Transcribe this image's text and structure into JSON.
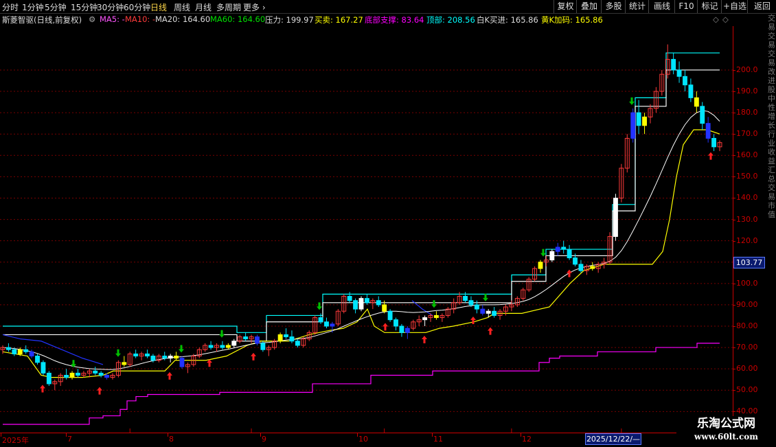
{
  "toolbar": {
    "periods": [
      "分时",
      "1分钟",
      "5分钟",
      "15分钟",
      "30分钟",
      "60分钟",
      "日线",
      "周线",
      "月线",
      "多周期",
      "更多"
    ],
    "active": "日线",
    "right_buttons": [
      "复权",
      "叠加",
      "多股",
      "统计",
      "画线",
      "F10",
      "标记",
      "+自选",
      "返回"
    ]
  },
  "infobar": {
    "title": "斯菱智驱(日线,前复权)",
    "ma5": "MA5: -",
    "ma10": "MA10: -",
    "ma20": "MA20: 164.60",
    "ma60": "MA60: 164.60",
    "pressure": "压力: 199.97",
    "trade": "买卖: 167.27",
    "bottom_support": "底部支撑: 83.64",
    "top": "顶部: 208.56",
    "white_k_buy": "白K买进: 165.86",
    "yellow_k_add": "黄K加码: 165.86"
  },
  "colors": {
    "up": "#ff3b3b",
    "down": "#00e5ff",
    "yellow": "#ffff00",
    "blue": "#0000ff",
    "magenta": "#ff00ff",
    "cyan": "#00ffff",
    "white": "#ffffff",
    "grid": "#7a0000",
    "axis": "#c00000",
    "buy_arrow": "#ff2020",
    "sell_arrow": "#00c000"
  },
  "price_axis": {
    "ticks": [
      40,
      50,
      60,
      70,
      80,
      90,
      100,
      110,
      120,
      130,
      140,
      150,
      160,
      170,
      180,
      190,
      200
    ],
    "labels": [
      "40.00",
      "50.00",
      "60.00",
      "70.00",
      "80.00",
      "90.00",
      "100.0",
      "110.0",
      "120.0",
      "130.0",
      "140.0",
      "150.0",
      "160.0",
      "170.0",
      "180.0",
      "190.0",
      "200.0"
    ],
    "current_price": "103.77"
  },
  "time_axis": {
    "labels": [
      "2025年",
      "7",
      "8",
      "9",
      "10",
      "11",
      "12"
    ],
    "cursor_date": "2025/12/22/—"
  },
  "right_strip_text": "交易交易交易改进股中性增长行业收益汇总交易市值",
  "watermark": {
    "line1": "乐淘公式网",
    "line2": "www.60lt.com"
  },
  "chart_data": {
    "type": "candlestick",
    "title": "斯菱智驱(日线,前复权)",
    "ylim": [
      34,
      218
    ],
    "months": [
      "2025年",
      "7",
      "8",
      "9",
      "10",
      "11",
      "12"
    ],
    "candles": [
      [
        69,
        71,
        67,
        70
      ],
      [
        70,
        72,
        68,
        69
      ],
      [
        69,
        70,
        66,
        67
      ],
      [
        67,
        70,
        66,
        69
      ],
      [
        69,
        71,
        67,
        68
      ],
      [
        68,
        69,
        65,
        66
      ],
      [
        66,
        67,
        62,
        63
      ],
      [
        63,
        64,
        57,
        58
      ],
      [
        58,
        59,
        52,
        53
      ],
      [
        53,
        55,
        50,
        54
      ],
      [
        54,
        58,
        52,
        57
      ],
      [
        57,
        60,
        55,
        56
      ],
      [
        56,
        59,
        55,
        58
      ],
      [
        58,
        60,
        56,
        57
      ],
      [
        57,
        59,
        56,
        58
      ],
      [
        58,
        60,
        56,
        59
      ],
      [
        59,
        61,
        57,
        58
      ],
      [
        58,
        59,
        56,
        57
      ],
      [
        57,
        58,
        55,
        56
      ],
      [
        56,
        58,
        55,
        57
      ],
      [
        57,
        64,
        56,
        63
      ],
      [
        63,
        66,
        61,
        62
      ],
      [
        62,
        68,
        61,
        67
      ],
      [
        67,
        69,
        65,
        66
      ],
      [
        66,
        68,
        64,
        67
      ],
      [
        67,
        69,
        65,
        66
      ],
      [
        66,
        67,
        63,
        64
      ],
      [
        64,
        67,
        63,
        66
      ],
      [
        66,
        68,
        64,
        65
      ],
      [
        65,
        67,
        63,
        66
      ],
      [
        66,
        68,
        64,
        65
      ],
      [
        65,
        66,
        60,
        61
      ],
      [
        61,
        63,
        58,
        62
      ],
      [
        62,
        67,
        61,
        66
      ],
      [
        66,
        70,
        65,
        69
      ],
      [
        69,
        72,
        68,
        71
      ],
      [
        71,
        73,
        69,
        70
      ],
      [
        70,
        72,
        68,
        71
      ],
      [
        71,
        73,
        69,
        70
      ],
      [
        70,
        72,
        69,
        71
      ],
      [
        71,
        74,
        70,
        73
      ],
      [
        73,
        76,
        72,
        75
      ],
      [
        75,
        77,
        73,
        74
      ],
      [
        74,
        76,
        72,
        75
      ],
      [
        75,
        76,
        71,
        72
      ],
      [
        72,
        73,
        68,
        69
      ],
      [
        69,
        71,
        66,
        70
      ],
      [
        70,
        74,
        69,
        73
      ],
      [
        73,
        77,
        72,
        76
      ],
      [
        76,
        79,
        74,
        75
      ],
      [
        75,
        78,
        72,
        73
      ],
      [
        73,
        74,
        70,
        71
      ],
      [
        71,
        75,
        70,
        74
      ],
      [
        74,
        78,
        73,
        77
      ],
      [
        77,
        85,
        76,
        84
      ],
      [
        84,
        86,
        81,
        82
      ],
      [
        82,
        84,
        79,
        80
      ],
      [
        80,
        82,
        77,
        81
      ],
      [
        81,
        88,
        80,
        87
      ],
      [
        87,
        95,
        86,
        94
      ],
      [
        94,
        96,
        91,
        92
      ],
      [
        92,
        93,
        86,
        88
      ],
      [
        88,
        94,
        87,
        93
      ],
      [
        93,
        95,
        90,
        91
      ],
      [
        91,
        93,
        88,
        92
      ],
      [
        92,
        94,
        89,
        90
      ],
      [
        90,
        92,
        86,
        87
      ],
      [
        87,
        88,
        82,
        83
      ],
      [
        83,
        84,
        78,
        80
      ],
      [
        80,
        81,
        75,
        77
      ],
      [
        77,
        80,
        74,
        79
      ],
      [
        79,
        83,
        78,
        82
      ],
      [
        82,
        85,
        80,
        83
      ],
      [
        83,
        85,
        80,
        84
      ],
      [
        84,
        86,
        82,
        85
      ],
      [
        85,
        87,
        83,
        84
      ],
      [
        84,
        86,
        82,
        85
      ],
      [
        85,
        89,
        84,
        88
      ],
      [
        88,
        93,
        86,
        91
      ],
      [
        91,
        96,
        90,
        94
      ],
      [
        94,
        96,
        91,
        92
      ],
      [
        92,
        94,
        89,
        90
      ],
      [
        90,
        92,
        86,
        88
      ],
      [
        88,
        90,
        85,
        86
      ],
      [
        86,
        88,
        84,
        87
      ],
      [
        87,
        89,
        84,
        85
      ],
      [
        85,
        88,
        83,
        87
      ],
      [
        87,
        90,
        85,
        89
      ],
      [
        89,
        92,
        87,
        90
      ],
      [
        90,
        94,
        89,
        93
      ],
      [
        93,
        98,
        92,
        97
      ],
      [
        97,
        103,
        96,
        102
      ],
      [
        102,
        108,
        101,
        107
      ],
      [
        107,
        111,
        105,
        110
      ],
      [
        110,
        113,
        108,
        111
      ],
      [
        111,
        116,
        110,
        115
      ],
      [
        115,
        119,
        113,
        117
      ],
      [
        117,
        120,
        114,
        116
      ],
      [
        116,
        118,
        111,
        112
      ],
      [
        112,
        114,
        108,
        109
      ],
      [
        109,
        111,
        105,
        106
      ],
      [
        106,
        109,
        104,
        108
      ],
      [
        108,
        110,
        106,
        107
      ],
      [
        107,
        110,
        105,
        109
      ],
      [
        109,
        112,
        107,
        110
      ],
      [
        110,
        124,
        109,
        122
      ],
      [
        122,
        142,
        120,
        140
      ],
      [
        140,
        156,
        138,
        154
      ],
      [
        154,
        170,
        152,
        168
      ],
      [
        168,
        182,
        166,
        180
      ],
      [
        180,
        186,
        170,
        174
      ],
      [
        174,
        180,
        170,
        178
      ],
      [
        178,
        184,
        175,
        182
      ],
      [
        182,
        192,
        180,
        190
      ],
      [
        190,
        200,
        188,
        198
      ],
      [
        198,
        212,
        196,
        205
      ],
      [
        205,
        208,
        198,
        200
      ],
      [
        200,
        204,
        194,
        197
      ],
      [
        197,
        200,
        190,
        193
      ],
      [
        193,
        196,
        185,
        187
      ],
      [
        187,
        190,
        180,
        183
      ],
      [
        183,
        185,
        172,
        175
      ],
      [
        175,
        178,
        166,
        168
      ],
      [
        168,
        170,
        162,
        164
      ],
      [
        164,
        167,
        162,
        166
      ]
    ],
    "ma_white": [
      70,
      69.8,
      69.5,
      69.1,
      68.6,
      68,
      67.2,
      66.2,
      65,
      63.8,
      62.8,
      62,
      61.3,
      60.8,
      60.4,
      60.1,
      59.9,
      59.8,
      59.7,
      59.7,
      60,
      60.5,
      61.1,
      61.8,
      62.5,
      63.2,
      63.8,
      64.3,
      64.8,
      65.2,
      65.5,
      65.7,
      65.9,
      66.2,
      66.6,
      67.1,
      67.6,
      68.2,
      68.7,
      69.2,
      69.8,
      70.4,
      71,
      71.6,
      72,
      72.2,
      72.4,
      72.7,
      73.1,
      73.5,
      73.8,
      74,
      74.3,
      74.7,
      75.4,
      76.2,
      77,
      77.8,
      78.8,
      80,
      81.2,
      82.3,
      83.4,
      84.4,
      85.3,
      86.1,
      86.7,
      87,
      87,
      86.8,
      86.5,
      86.4,
      86.5,
      86.7,
      87,
      87.3,
      87.5,
      87.8,
      88.2,
      88.7,
      89.2,
      89.6,
      89.9,
      90,
      90,
      90,
      90.1,
      90.3,
      90.6,
      91,
      91.6,
      92.5,
      93.8,
      95.4,
      97.2,
      99.2,
      101.3,
      103.3,
      105,
      106.3,
      107.3,
      108,
      108.5,
      108.9,
      109.4,
      110.4,
      112.3,
      115.4,
      119.6,
      124.6,
      129.8,
      135.2,
      140.8,
      146.7,
      152.8,
      159,
      164.8,
      170,
      174.4,
      177.8,
      180,
      181,
      180.6,
      178.8,
      176
    ]
  }
}
